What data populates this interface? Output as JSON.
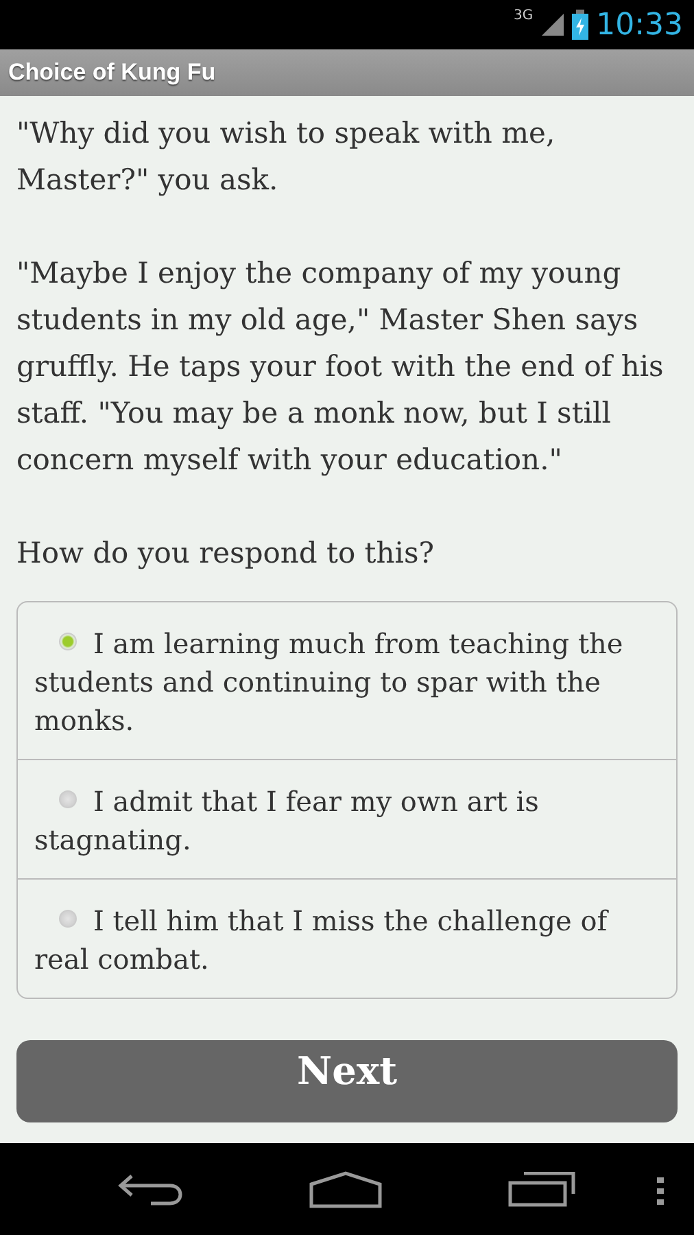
{
  "status_bar": {
    "network": "3G",
    "time": "10:33"
  },
  "title": "Choice of Kung Fu",
  "paragraphs": [
    "\"Why did you wish to speak with me, Master?\" you ask.",
    "\"Maybe I enjoy the company of my young students in my old age,\" Master Shen says gruffly. He taps your foot with the end of his staff. \"You may be a monk now, but I still concern myself with your education.\"",
    "How do you respond to this?"
  ],
  "choices": [
    {
      "text": "I am learning much from teaching the students and continuing to spar with the monks.",
      "selected": true
    },
    {
      "text": "I admit that I fear my own art is stagnating.",
      "selected": false
    },
    {
      "text": "I tell him that I miss the challenge of real combat.",
      "selected": false
    }
  ],
  "next_button": "Next"
}
